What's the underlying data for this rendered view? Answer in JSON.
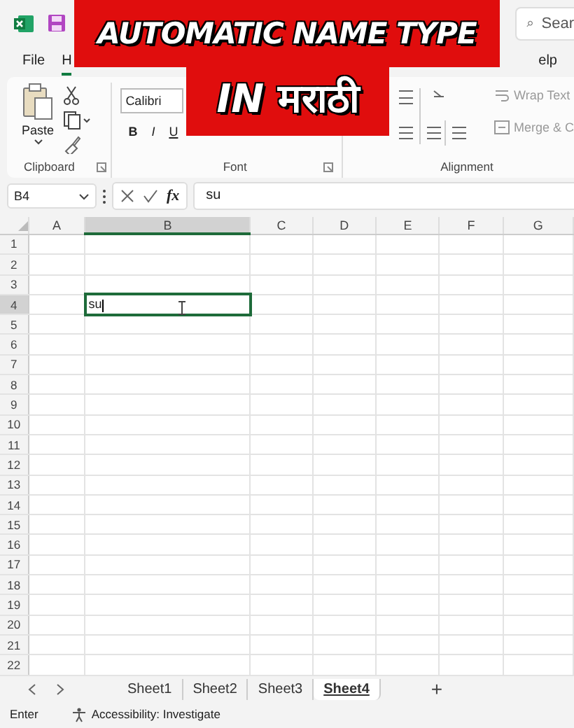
{
  "title_bar": {
    "search_placeholder": "Sear"
  },
  "banner": {
    "line_1": "AUTOMATIC NAME TYPE",
    "line_2_latin": "IN",
    "line_2_script": "मराठी"
  },
  "menu_tabs": [
    {
      "label": "File",
      "selected": false
    },
    {
      "label": "H",
      "selected": true
    },
    {
      "label": "elp",
      "selected": false
    }
  ],
  "ribbon": {
    "clipboard": {
      "paste": "Paste",
      "label": "Clipboard"
    },
    "font": {
      "font_name": "Calibri",
      "bold": "B",
      "italic": "I",
      "underline": "U",
      "label": "Font"
    },
    "alignment": {
      "wrap_text": "Wrap Text",
      "merge": "Merge & C",
      "label": "Alignment"
    }
  },
  "formula_bar": {
    "name_box": "B4",
    "fx": "fx",
    "value": "su"
  },
  "columns": [
    {
      "label": "A",
      "selected": false
    },
    {
      "label": "B",
      "selected": true
    },
    {
      "label": "C",
      "selected": false
    },
    {
      "label": "D",
      "selected": false
    },
    {
      "label": "E",
      "selected": false
    },
    {
      "label": "F",
      "selected": false
    },
    {
      "label": "G",
      "selected": false
    }
  ],
  "rows": [
    {
      "label": "1",
      "selected": false
    },
    {
      "label": "2",
      "selected": false
    },
    {
      "label": "3",
      "selected": false
    },
    {
      "label": "4",
      "selected": true,
      "entry": "su"
    },
    {
      "label": "5",
      "selected": false
    },
    {
      "label": "6",
      "selected": false
    },
    {
      "label": "7",
      "selected": false
    },
    {
      "label": "8",
      "selected": false
    },
    {
      "label": "9",
      "selected": false
    },
    {
      "label": "10",
      "selected": false
    },
    {
      "label": "11",
      "selected": false
    },
    {
      "label": "12",
      "selected": false
    },
    {
      "label": "13",
      "selected": false
    },
    {
      "label": "14",
      "selected": false
    },
    {
      "label": "15",
      "selected": false
    },
    {
      "label": "16",
      "selected": false
    },
    {
      "label": "17",
      "selected": false
    },
    {
      "label": "18",
      "selected": false
    },
    {
      "label": "19",
      "selected": false
    },
    {
      "label": "20",
      "selected": false
    },
    {
      "label": "21",
      "selected": false
    },
    {
      "label": "22",
      "selected": false
    }
  ],
  "sheet_tabs": [
    {
      "label": "Sheet1",
      "selected": false
    },
    {
      "label": "Sheet2",
      "selected": false
    },
    {
      "label": "Sheet3",
      "selected": false
    },
    {
      "label": "Sheet4",
      "selected": true
    }
  ],
  "add_sheet": "+",
  "status_bar": {
    "mode": "Enter",
    "accessibility": "Accessibility: Investigate"
  }
}
